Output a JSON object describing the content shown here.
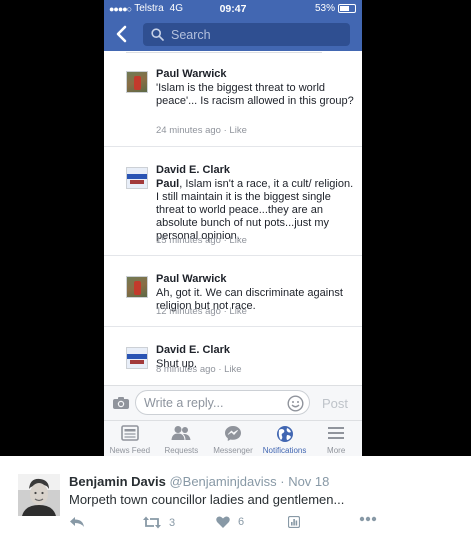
{
  "status_bar": {
    "signal": "●●●●○",
    "carrier": "Telstra",
    "network": "4G",
    "time": "09:47",
    "battery": "53%"
  },
  "nav": {
    "search_placeholder": "Search"
  },
  "comments": [
    {
      "author": "Paul Warwick",
      "tag": "",
      "text": "'Islam is the biggest threat to world peace'... Is racism allowed in this group?",
      "time": "24 minutes ago",
      "like": "Like",
      "avatar": "paul"
    },
    {
      "author": "David E. Clark",
      "tag": "Paul",
      "text": ",  Islam isn't a race, it a cult/ religion.  I still maintain it is the biggest single threat to world peace...they are an absolute bunch of nut pots...just my personal opinion.",
      "time": "15 minutes ago",
      "like": "Like",
      "avatar": "david"
    },
    {
      "author": "Paul Warwick",
      "tag": "",
      "text": "Ah, got it. We can discriminate against religion but not race.",
      "time": "12 minutes ago",
      "like": "Like",
      "avatar": "paul"
    },
    {
      "author": "David E. Clark",
      "tag": "",
      "text": "Shut up.",
      "time": "8 minutes ago",
      "like": "Like",
      "avatar": "david"
    }
  ],
  "meta_separator": "·",
  "reply": {
    "placeholder": "Write a reply...",
    "post_label": "Post"
  },
  "tabs": [
    {
      "label": "News Feed",
      "icon": "news-feed-icon",
      "active": false
    },
    {
      "label": "Requests",
      "icon": "friend-requests-icon",
      "active": false
    },
    {
      "label": "Messenger",
      "icon": "messenger-icon",
      "active": false
    },
    {
      "label": "Notifications",
      "icon": "globe-icon",
      "active": true
    },
    {
      "label": "More",
      "icon": "menu-icon",
      "active": false
    }
  ],
  "tweet": {
    "name": "Benjamin Davis",
    "handle": "@Benjaminjdaviss",
    "separator": "·",
    "date": "Nov 18",
    "text": "Morpeth town councillor ladies and gentlemen...",
    "retweets": "3",
    "likes": "6"
  },
  "colors": {
    "facebook_blue": "#4267b2",
    "search_bg": "#2f4f91",
    "muted_text": "#90949c",
    "twitter_gray": "#8899a6"
  }
}
